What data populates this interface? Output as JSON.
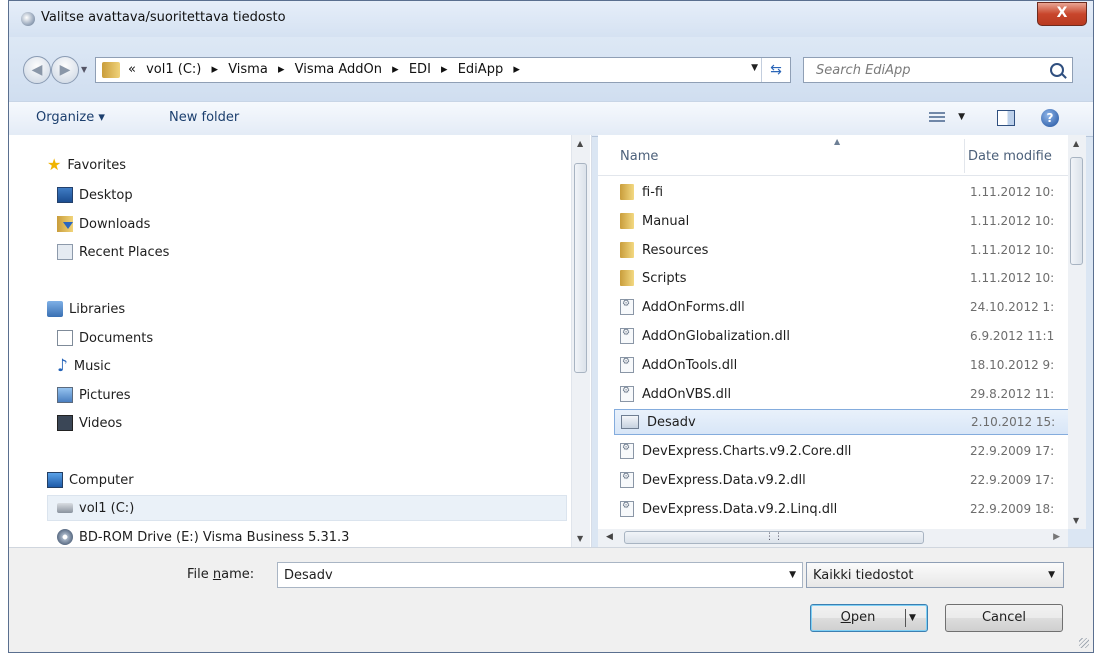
{
  "window": {
    "title": "Valitse avattava/suoritettava tiedosto",
    "close_label": "X"
  },
  "address": {
    "breadcrumbs": [
      "«",
      "vol1 (C:)",
      "▸",
      "Visma",
      "▸",
      "Visma AddOn",
      "▸",
      "EDI",
      "▸",
      "EdiApp",
      "▸"
    ],
    "search_placeholder": "Search EdiApp"
  },
  "toolbar": {
    "organize_label": "Organize ▾",
    "new_folder_label": "New folder"
  },
  "nav": {
    "favorites": "Favorites",
    "favorites_items": [
      "Desktop",
      "Downloads",
      "Recent Places"
    ],
    "libraries": "Libraries",
    "libraries_items": [
      "Documents",
      "Music",
      "Pictures",
      "Videos"
    ],
    "computer": "Computer",
    "computer_items": [
      "vol1 (C:)",
      "BD-ROM Drive (E:) Visma Business 5.31.3"
    ]
  },
  "columns": {
    "name": "Name",
    "date": "Date modifie"
  },
  "files": [
    {
      "name": "fi-fi",
      "date": "1.11.2012 10:",
      "type": "folder"
    },
    {
      "name": "Manual",
      "date": "1.11.2012 10:",
      "type": "folder"
    },
    {
      "name": "Resources",
      "date": "1.11.2012 10:",
      "type": "folder"
    },
    {
      "name": "Scripts",
      "date": "1.11.2012 10:",
      "type": "folder"
    },
    {
      "name": "AddOnForms.dll",
      "date": "24.10.2012 1:",
      "type": "dll"
    },
    {
      "name": "AddOnGlobalization.dll",
      "date": "6.9.2012 11:1",
      "type": "dll"
    },
    {
      "name": "AddOnTools.dll",
      "date": "18.10.2012 9:",
      "type": "dll"
    },
    {
      "name": "AddOnVBS.dll",
      "date": "29.8.2012 11:",
      "type": "dll"
    },
    {
      "name": "Desadv",
      "date": "2.10.2012 15:",
      "type": "form"
    },
    {
      "name": "DevExpress.Charts.v9.2.Core.dll",
      "date": "22.9.2009 17:",
      "type": "dll"
    },
    {
      "name": "DevExpress.Data.v9.2.dll",
      "date": "22.9.2009 17:",
      "type": "dll"
    },
    {
      "name": "DevExpress.Data.v9.2.Linq.dll",
      "date": "22.9.2009 18:",
      "type": "dll"
    }
  ],
  "footer": {
    "file_name_label_prefix": "File ",
    "file_name_label_accel": "n",
    "file_name_label_suffix": "ame:",
    "file_name_value": "Desadv",
    "filter_value": "Kaikki tiedostot",
    "open_accel": "O",
    "open_rest": "pen",
    "cancel_label": "Cancel"
  }
}
